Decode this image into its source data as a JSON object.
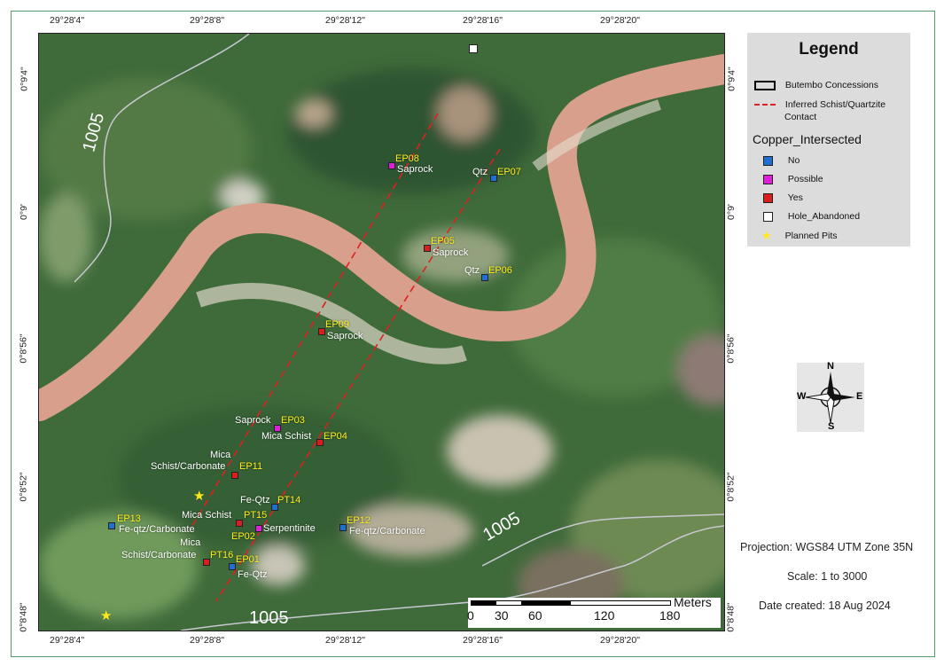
{
  "coords": {
    "top": [
      "29°28'4\"",
      "29°28'8\"",
      "29°28'12\"",
      "29°28'16\"",
      "29°28'20\""
    ],
    "bottom": [
      "29°28'4\"",
      "29°28'8\"",
      "29°28'12\"",
      "29°28'16\"",
      "29°28'20\""
    ],
    "left": [
      "0°9'4\"",
      "0°9'",
      "0°8'56\"",
      "0°8'52\"",
      "0°8'48\""
    ],
    "right": [
      "0°9'4\"",
      "0°9'",
      "0°8'56\"",
      "0°8'52\"",
      "0°8'48\""
    ]
  },
  "legend": {
    "title": "Legend",
    "concessions": "Butembo Concessions",
    "contact_line1": "Inferred Schist/Quartzite",
    "contact_line2": "Contact",
    "section": "Copper_Intersected",
    "items": [
      {
        "label": "No",
        "color": "#1f6fd1"
      },
      {
        "label": "Possible",
        "color": "#e020d8"
      },
      {
        "label": "Yes",
        "color": "#d81e1e"
      },
      {
        "label": "Hole_Abandoned",
        "color": "#ffffff"
      },
      {
        "label": "Planned Pits",
        "color": "#ffe81a"
      }
    ]
  },
  "info": {
    "projection": "Projection: WGS84 UTM Zone 35N",
    "scale": "Scale: 1 to 3000",
    "date": "Date created: 18 Aug 2024"
  },
  "compass": {
    "n": "N",
    "s": "S",
    "e": "E",
    "w": "W"
  },
  "scalebar": {
    "unit": "Meters",
    "ticks": [
      "0",
      "30",
      "60",
      "120",
      "180"
    ]
  },
  "roads": {
    "label": "1005"
  },
  "points": [
    {
      "id": "EP08",
      "rock": "Saprock",
      "status": "Possible"
    },
    {
      "id": "EP07",
      "rock": "Qtz",
      "status": "No"
    },
    {
      "id": "EP05",
      "rock": "Saprock",
      "status": "Yes"
    },
    {
      "id": "EP06",
      "rock": "Qtz",
      "status": "No"
    },
    {
      "id": "EP09",
      "rock": "Saprock",
      "status": "Yes"
    },
    {
      "id": "EP03",
      "rock": "Saprock",
      "status": "Possible"
    },
    {
      "id": "EP04",
      "rock": "Mica Schist",
      "status": "Yes"
    },
    {
      "id": "EP11",
      "rock_line1": "Mica",
      "rock_line2": "Schist/Carbonate",
      "status": "Yes"
    },
    {
      "id": "PT14",
      "rock": "Fe-Qtz",
      "status": "No"
    },
    {
      "id": "PT15",
      "rock": "Mica Schist",
      "status": "Yes"
    },
    {
      "id": "EP02",
      "rock": "Serpentinite",
      "status": "Possible"
    },
    {
      "id": "EP13",
      "rock": "Fe-qtz/Carbonate",
      "status": "No"
    },
    {
      "id": "EP12",
      "rock": "Fe-qtz/Carbonate",
      "status": "No"
    },
    {
      "id": "PT16",
      "rock_line1": "Mica",
      "rock_line2": "Schist/Carbonate",
      "status": "Yes"
    },
    {
      "id": "EP01",
      "rock": "Fe-Qtz",
      "status": "No"
    }
  ]
}
